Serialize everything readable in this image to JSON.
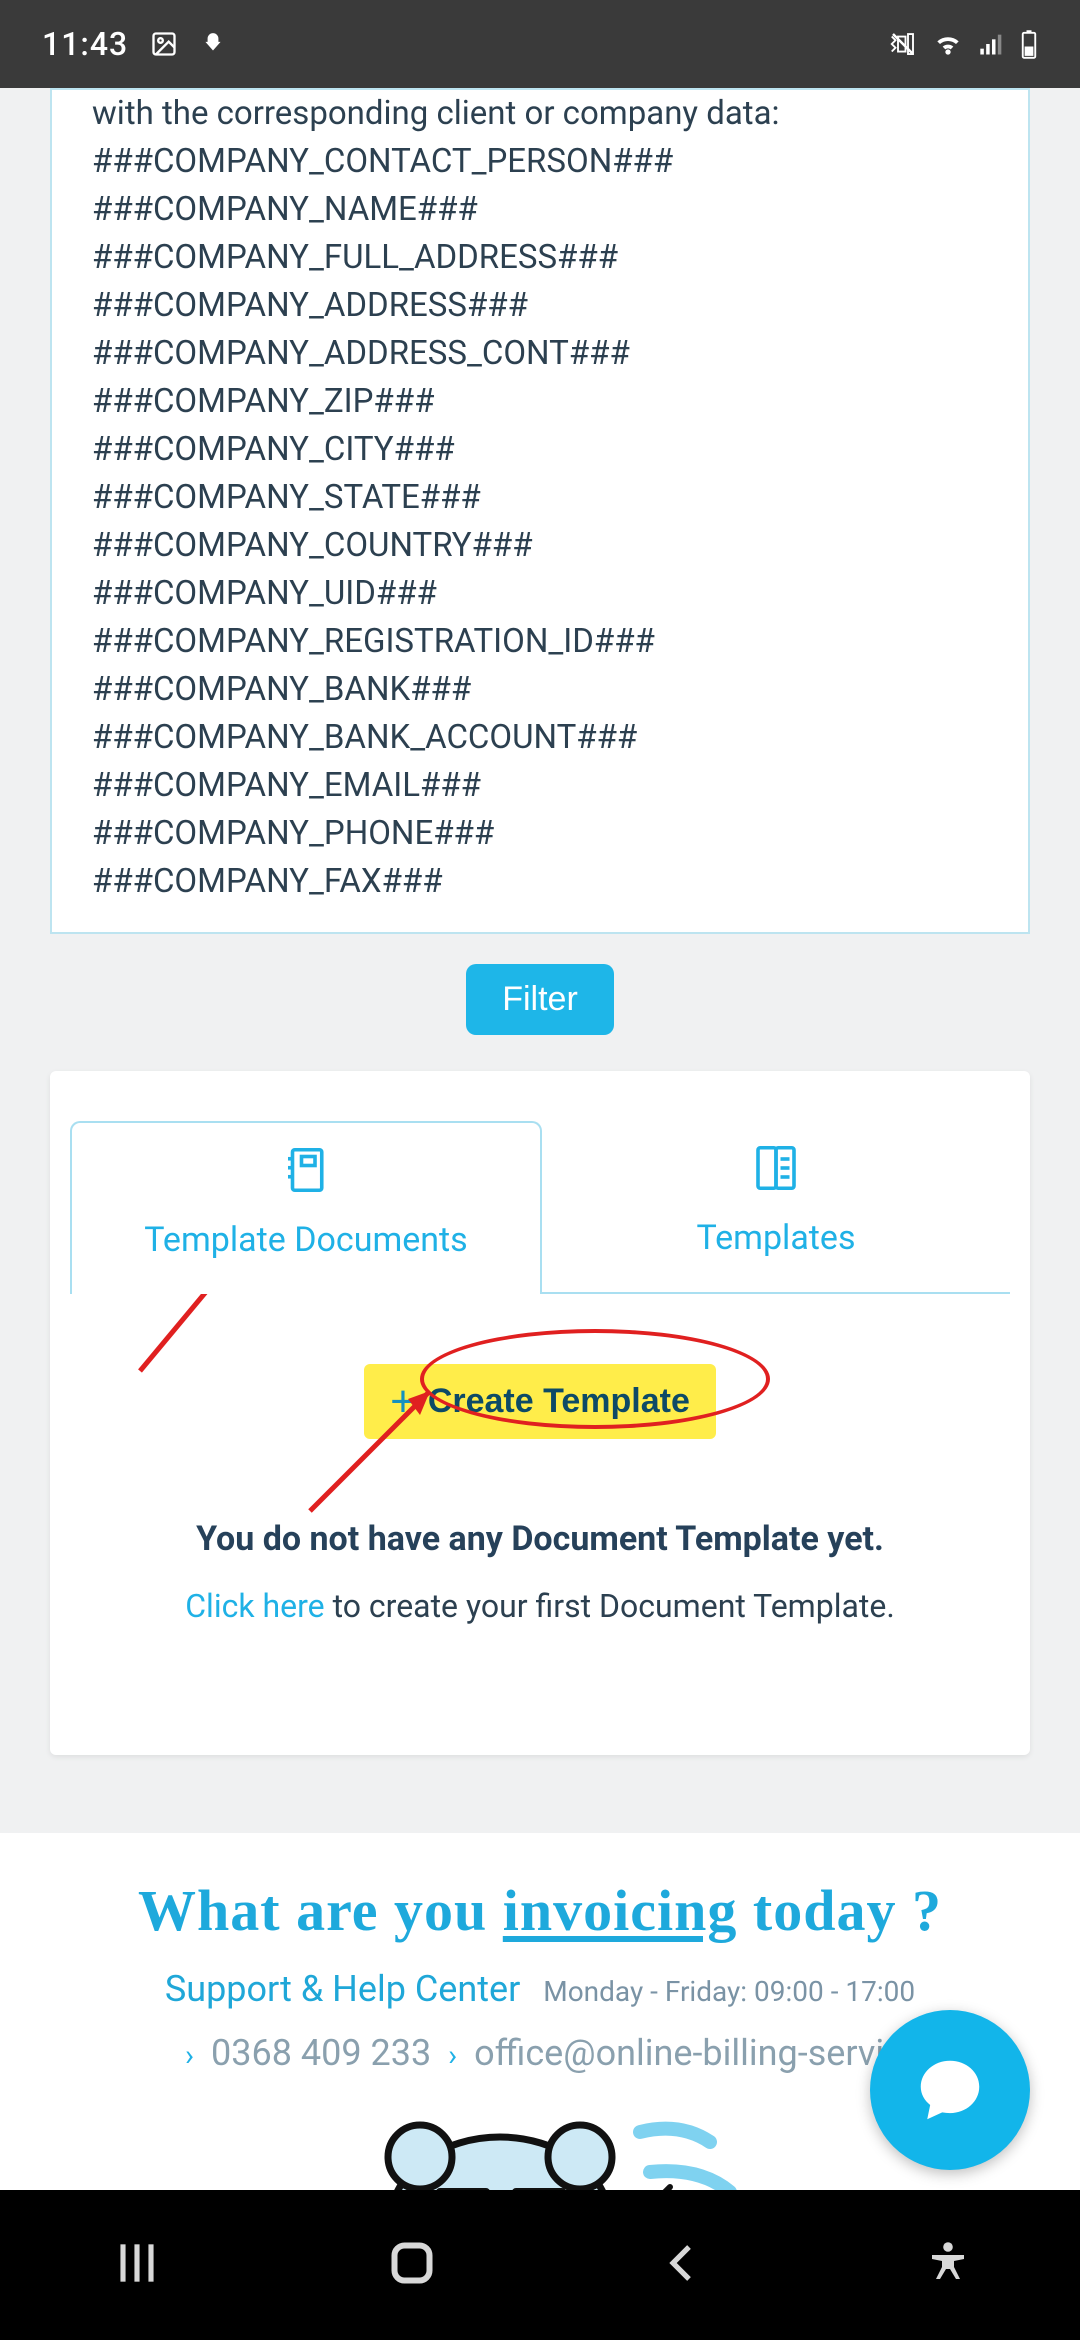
{
  "status": {
    "time": "11:43",
    "icons_left": [
      "image-icon",
      "download-icon"
    ],
    "icons_right": [
      "vibrate-icon",
      "wifi-icon",
      "signal-icon",
      "battery-icon"
    ]
  },
  "placeholders": {
    "lead": "with the corresponding client or company data:",
    "vars": [
      "###COMPANY_CONTACT_PERSON###",
      "###COMPANY_NAME###",
      "###COMPANY_FULL_ADDRESS###",
      "###COMPANY_ADDRESS###",
      "###COMPANY_ADDRESS_CONT###",
      "###COMPANY_ZIP###",
      "###COMPANY_CITY###",
      "###COMPANY_STATE###",
      "###COMPANY_COUNTRY###",
      "###COMPANY_UID###",
      "###COMPANY_REGISTRATION_ID###",
      "###COMPANY_BANK###",
      "###COMPANY_BANK_ACCOUNT###",
      "###COMPANY_EMAIL###",
      "###COMPANY_PHONE###",
      "###COMPANY_FAX###"
    ]
  },
  "filter": {
    "label": "Filter"
  },
  "tabs": {
    "active": {
      "label": "Template Documents"
    },
    "inactive": {
      "label": "Templates"
    }
  },
  "create": {
    "label": "Create Template"
  },
  "empty": {
    "heading": "You do not have any Document Template yet.",
    "link": "Click here",
    "rest": " to create your first Document Template."
  },
  "footer": {
    "tagline_a": "What are you ",
    "tagline_b": "invoicing",
    "tagline_c": " today ?",
    "support": "Support & Help Center",
    "hours": "Monday - Friday: 09:00 - 17:00",
    "phone": "0368 409 233",
    "email": "office@online-billing-servic"
  },
  "colors": {
    "accent": "#1fb1e6",
    "highlight": "#ffed4a",
    "annotation": "#e02020"
  }
}
